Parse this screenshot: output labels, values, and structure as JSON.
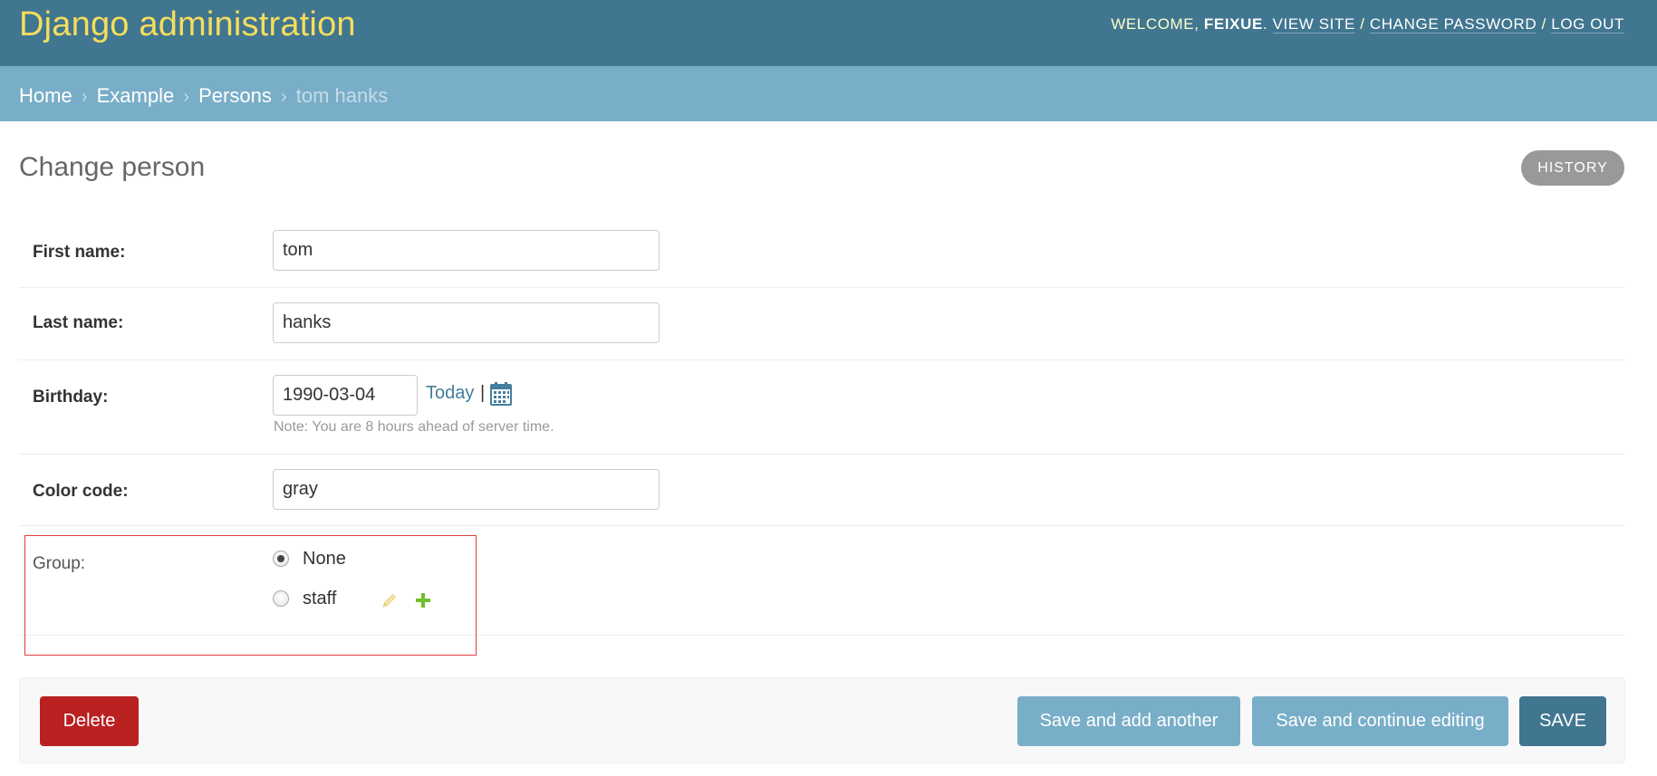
{
  "header": {
    "branding": "Django administration",
    "welcome": "Welcome,",
    "username": "feixue",
    "view_site": "View site",
    "change_password": "Change password",
    "log_out": "Log out"
  },
  "breadcrumbs": {
    "home": "Home",
    "app": "Example",
    "model": "Persons",
    "current": "tom hanks",
    "separator": "›"
  },
  "page": {
    "title": "Change person",
    "history_label": "History"
  },
  "form": {
    "first_name": {
      "label": "First name:",
      "value": "tom"
    },
    "last_name": {
      "label": "Last name:",
      "value": "hanks"
    },
    "birthday": {
      "label": "Birthday:",
      "value": "1990-03-04",
      "today_link": "Today",
      "pipe": "|",
      "note": "Note: You are 8 hours ahead of server time."
    },
    "color_code": {
      "label": "Color code:",
      "value": "gray"
    },
    "group": {
      "label": "Group:",
      "options": [
        {
          "label": "None",
          "checked": true
        },
        {
          "label": "staff",
          "checked": false
        }
      ]
    }
  },
  "submit_row": {
    "delete": "Delete",
    "save_add_another": "Save and add another",
    "save_continue": "Save and continue editing",
    "save": "Save"
  },
  "colors": {
    "header_bg": "#417690",
    "branding": "#f5dd5d",
    "breadcrumbs_bg": "#79aec8",
    "delete_bg": "#ba2121",
    "secondary_button_bg": "#79aec8",
    "primary_button_bg": "#417690",
    "highlight_border": "#e23c3c"
  }
}
